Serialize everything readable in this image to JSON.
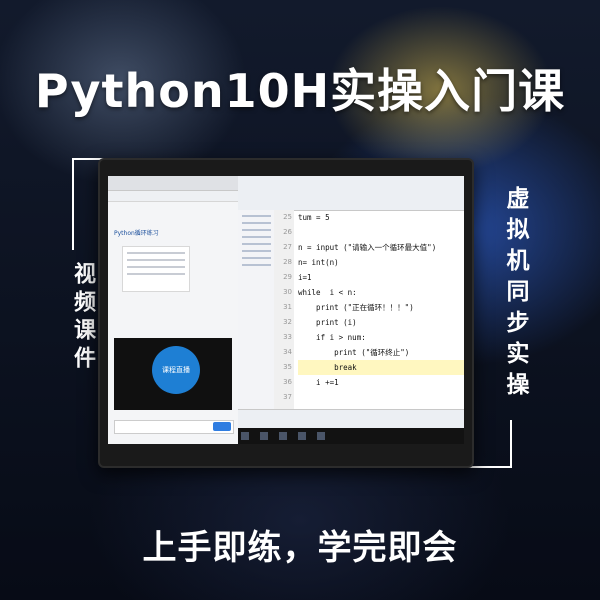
{
  "banner": {
    "title": "Python10H实操入门课",
    "left_vertical": "视频课件",
    "right_vertical": "虚拟机同步实操",
    "slogan": "上手即练，学完即会"
  },
  "screen": {
    "left_panel": {
      "heading": "Python循环练习",
      "video_badge": "课程直播"
    },
    "ide": {
      "line_numbers": [
        "25",
        "26",
        "27",
        "28",
        "29",
        "30",
        "31",
        "32",
        "33",
        "34",
        "35",
        "36",
        "37"
      ],
      "code_lines": [
        "tum = 5",
        "",
        "n = input (\"请输入一个循环最大值\")",
        "n= int(n)",
        "i=1",
        "while  i < n:",
        "    print (\"正在循环！！！\")",
        "    print (i)",
        "    if i > num:",
        "        print (\"循环终止\")",
        "        break",
        "    i +=1",
        ""
      ]
    }
  },
  "colors": {
    "title": "#ffffff",
    "accent_blue": "#1e7fd4",
    "ide_highlight": "#fff7c0"
  }
}
